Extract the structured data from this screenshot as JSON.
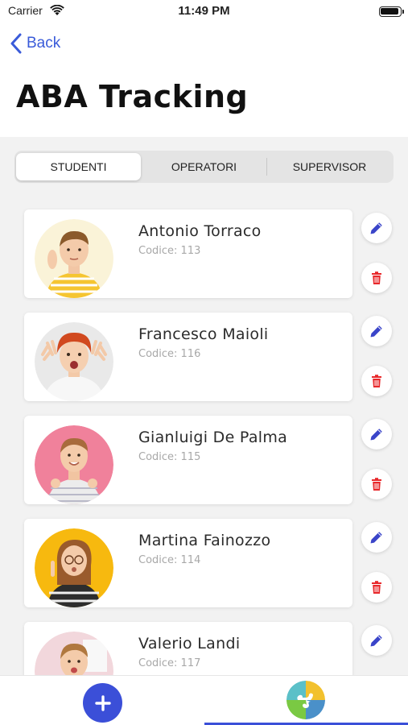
{
  "status_bar": {
    "carrier": "Carrier",
    "time": "11:49 PM"
  },
  "nav": {
    "back_label": "Back",
    "title": "ABA Tracking"
  },
  "segments": [
    {
      "label": "STUDENTI",
      "active": true
    },
    {
      "label": "OPERATORI",
      "active": false
    },
    {
      "label": "SUPERVISOR",
      "active": false
    }
  ],
  "students": [
    {
      "name": "Antonio Torraco",
      "code": "Codice: 113",
      "avatar_bg": "#f6e27a",
      "shirt": "#f5c531",
      "hair": "#8b5a2b"
    },
    {
      "name": "Francesco Maioli",
      "code": "Codice: 116",
      "avatar_bg": "#e6e6e6",
      "shirt": "#f4f4f4",
      "hair": "#d1491f"
    },
    {
      "name": "Gianluigi De Palma",
      "code": "Codice: 115",
      "avatar_bg": "#f0819b",
      "shirt": "#e8e8e8",
      "hair": "#a86b3c"
    },
    {
      "name": "Martina Fainozzo",
      "code": "Codice: 114",
      "avatar_bg": "#f7b90f",
      "shirt": "#2d2d2d",
      "hair": "#9a5b2c"
    },
    {
      "name": "Valerio Landi",
      "code": "Codice: 117",
      "avatar_bg": "#f2d7dc",
      "shirt": "#5b8fc6",
      "hair": "#b0783f"
    }
  ],
  "icons": {
    "edit": "pencil-icon",
    "delete": "trash-icon",
    "add": "plus-icon",
    "puzzle": "puzzle-icon"
  },
  "colors": {
    "accent": "#3b4fd8",
    "delete": "#e8282b",
    "edit": "#3a45c9"
  }
}
